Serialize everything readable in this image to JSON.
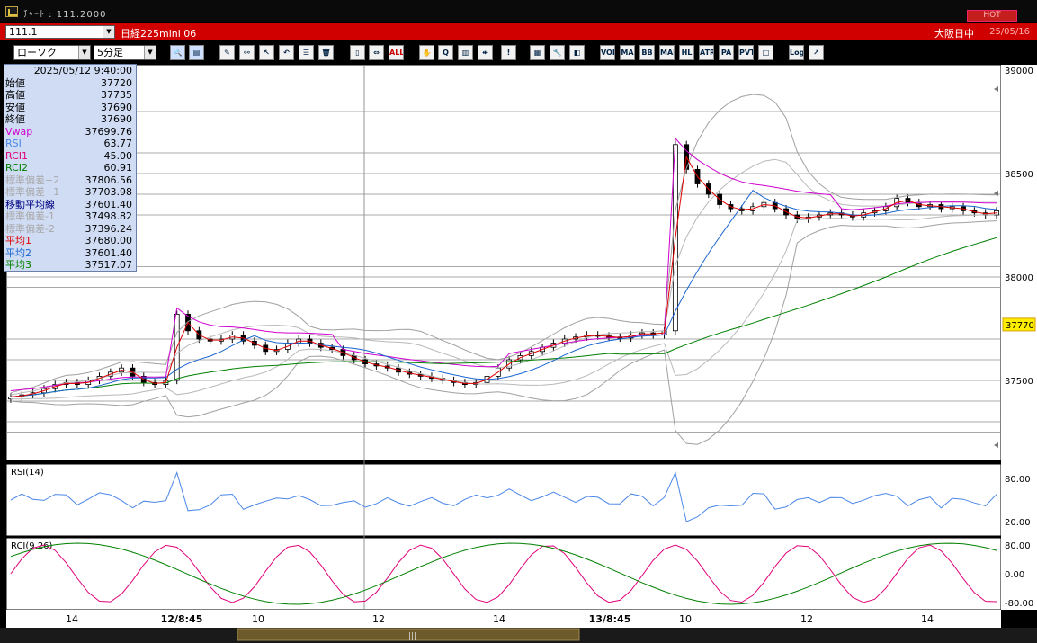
{
  "window": {
    "title_text": "ﾁｬｰﾄ : 111.2000",
    "title_btn": "HOT"
  },
  "symbolbar": {
    "symbol_code": "111.1",
    "symbol_name": "日経225mini 06",
    "session": "大阪日中",
    "date": "25/05/16"
  },
  "toolbar": {
    "chart_type": "ローソク",
    "interval": "5分足",
    "buttons": [
      {
        "name": "zoom-icon",
        "glyph": "🔍"
      },
      {
        "name": "layout-icon",
        "glyph": "▤"
      },
      {
        "name": "pen-icon",
        "glyph": "✎"
      },
      {
        "name": "link-icon",
        "glyph": "⚯"
      },
      {
        "name": "cursor-icon",
        "glyph": "↖"
      },
      {
        "name": "undo-icon",
        "glyph": "↶"
      },
      {
        "name": "list-icon",
        "glyph": "☰"
      },
      {
        "name": "trash-icon",
        "glyph": "🗑"
      },
      {
        "name": "candle-icon",
        "glyph": "▯"
      },
      {
        "name": "candle-range-icon",
        "glyph": "⇔"
      },
      {
        "name": "all-icon",
        "glyph": "ALL"
      },
      {
        "name": "hand-icon",
        "glyph": "✋"
      },
      {
        "name": "search-chart-icon",
        "glyph": "Q"
      },
      {
        "name": "bar-chart-icon",
        "glyph": "▥"
      },
      {
        "name": "split-icon",
        "glyph": "⇹"
      },
      {
        "name": "blank-icon",
        "glyph": "!"
      },
      {
        "name": "grid-icon",
        "glyph": "▦"
      },
      {
        "name": "wrench-icon",
        "glyph": "🔧"
      },
      {
        "name": "palette-icon",
        "glyph": "◧"
      },
      {
        "name": "vol-icon",
        "glyph": "VOL"
      },
      {
        "name": "ma-icon",
        "glyph": "MA"
      },
      {
        "name": "bb-icon",
        "glyph": "BB"
      },
      {
        "name": "mae-icon",
        "glyph": "MAE"
      },
      {
        "name": "hl-icon",
        "glyph": "HL"
      },
      {
        "name": "atr-icon",
        "glyph": "ATR"
      },
      {
        "name": "para-icon",
        "glyph": "PA"
      },
      {
        "name": "pvt-icon",
        "glyph": "PVT"
      },
      {
        "name": "box-icon",
        "glyph": "□"
      },
      {
        "name": "log-icon",
        "glyph": "Log"
      },
      {
        "name": "export-icon",
        "glyph": "↗"
      }
    ]
  },
  "info_panel": {
    "timestamp": "2025/05/12  9:40:00",
    "rows": [
      {
        "label": "始値",
        "value": "37720",
        "color": "#000000"
      },
      {
        "label": "高値",
        "value": "37735",
        "color": "#000000"
      },
      {
        "label": "安値",
        "value": "37690",
        "color": "#000000"
      },
      {
        "label": "終値",
        "value": "37690",
        "color": "#000000"
      },
      {
        "label": "Vwap",
        "value": "37699.76",
        "color": "#d000d0"
      },
      {
        "label": "RSI",
        "value": "63.77",
        "color": "#4a86e8"
      },
      {
        "label": "RCI1",
        "value": "45.00",
        "color": "#e0007a"
      },
      {
        "label": "RCI2",
        "value": "60.91",
        "color": "#008000"
      },
      {
        "label": "標準偏差+2",
        "value": "37806.56",
        "color": "#a8a8a8"
      },
      {
        "label": "標準偏差+1",
        "value": "37703.98",
        "color": "#a8a8a8"
      },
      {
        "label": "移動平均線",
        "value": "37601.40",
        "color": "#000080"
      },
      {
        "label": "標準偏差-1",
        "value": "37498.82",
        "color": "#a8a8a8"
      },
      {
        "label": "標準偏差-2",
        "value": "37396.24",
        "color": "#a8a8a8"
      },
      {
        "label": "平均1",
        "value": "37680.00",
        "color": "#e00000"
      },
      {
        "label": "平均2",
        "value": "37601.40",
        "color": "#1a66d0"
      },
      {
        "label": "平均3",
        "value": "37517.07",
        "color": "#008000"
      }
    ]
  },
  "chart": {
    "price_axis": [
      "39000",
      "38500",
      "38000",
      "37500"
    ],
    "current_price": "37770",
    "time_axis": [
      "14",
      "12/8:45",
      "10",
      "12",
      "14",
      "13/8:45",
      "10",
      "12",
      "14"
    ],
    "rsi_title": "RSI(14)",
    "rsi_axis": [
      "80.00",
      "20.00"
    ],
    "rci_title": "RCI(9,26)",
    "rci_axis": [
      "80.00",
      "0.00",
      "-80.00"
    ]
  },
  "chart_data": {
    "type": "candlestick",
    "ylim": [
      37200,
      39000
    ],
    "price_ticks": [
      39000,
      38500,
      38000,
      37500
    ],
    "current_price": 37770,
    "x_labels": [
      "14",
      "12/8:45",
      "10",
      "12",
      "14",
      "13/8:45",
      "10",
      "12",
      "14"
    ],
    "close_approx": [
      37420,
      37430,
      37440,
      37460,
      37480,
      37490,
      37480,
      37500,
      37520,
      37540,
      37560,
      37520,
      37490,
      37480,
      37500,
      37820,
      37740,
      37700,
      37690,
      37700,
      37720,
      37690,
      37670,
      37640,
      37650,
      37680,
      37700,
      37680,
      37660,
      37650,
      37620,
      37600,
      37580,
      37570,
      37560,
      37540,
      37530,
      37520,
      37510,
      37500,
      37490,
      37480,
      37490,
      37520,
      37560,
      37600,
      37620,
      37640,
      37660,
      37680,
      37700,
      37710,
      37720,
      37715,
      37710,
      37705,
      37720,
      37730,
      37720,
      37740,
      38640,
      38520,
      38450,
      38400,
      38350,
      38330,
      38320,
      38340,
      38360,
      38330,
      38300,
      38280,
      38290,
      38300,
      38310,
      38300,
      38290,
      38310,
      38320,
      38340,
      38380,
      38360,
      38340,
      38350,
      38330,
      38340,
      38320,
      38310,
      38300,
      38320
    ],
    "rsi": {
      "name": "RSI(14)",
      "ylim": [
        0,
        100
      ],
      "ticks": [
        80,
        20
      ]
    },
    "rci": {
      "name": "RCI(9,26)",
      "ylim": [
        -100,
        100
      ],
      "ticks": [
        80,
        0,
        -80
      ]
    }
  }
}
